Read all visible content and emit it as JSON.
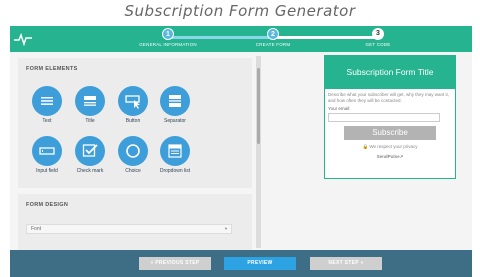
{
  "page_title": "Subscription Form Generator",
  "steps": [
    {
      "number": "1",
      "label": "GENERAL INFORMATION",
      "state": "done"
    },
    {
      "number": "2",
      "label": "CREATE FORM",
      "state": "done"
    },
    {
      "number": "3",
      "label": "GET CODE",
      "state": "todo"
    }
  ],
  "form_elements": {
    "title": "FORM ELEMENTS",
    "items": [
      {
        "label": "Text",
        "icon": "text-lines-icon"
      },
      {
        "label": "Title",
        "icon": "title-icon"
      },
      {
        "label": "Button",
        "icon": "button-cursor-icon"
      },
      {
        "label": "Separator",
        "icon": "separator-icon"
      },
      {
        "label": "Input field",
        "icon": "input-field-icon"
      },
      {
        "label": "Check mark",
        "icon": "checkmark-icon"
      },
      {
        "label": "Choice",
        "icon": "radio-choice-icon"
      },
      {
        "label": "Dropdown list",
        "icon": "dropdown-list-icon"
      }
    ]
  },
  "form_design": {
    "title": "FORM DESIGN",
    "font_select": "Font"
  },
  "preview": {
    "heading": "Subscription Form Title",
    "description": "Describe what your subscriber will get, why they may want it, and how often they will be contacted.",
    "email_label": "Your email:",
    "email_value": "",
    "subscribe_label": "Subscribe",
    "privacy_text": "We respect your privacy",
    "brand": "SendPulse↗"
  },
  "bottom_bar": {
    "prev_label": "« PREVIOUS STEP",
    "preview_label": "PREVIEW",
    "next_label": "NEXT STEP »"
  },
  "colors": {
    "accent_green": "#25b390",
    "icon_blue": "#3d9ed9",
    "bottom_bar": "#3d6e86",
    "preview_button": "#2ea3e3"
  }
}
